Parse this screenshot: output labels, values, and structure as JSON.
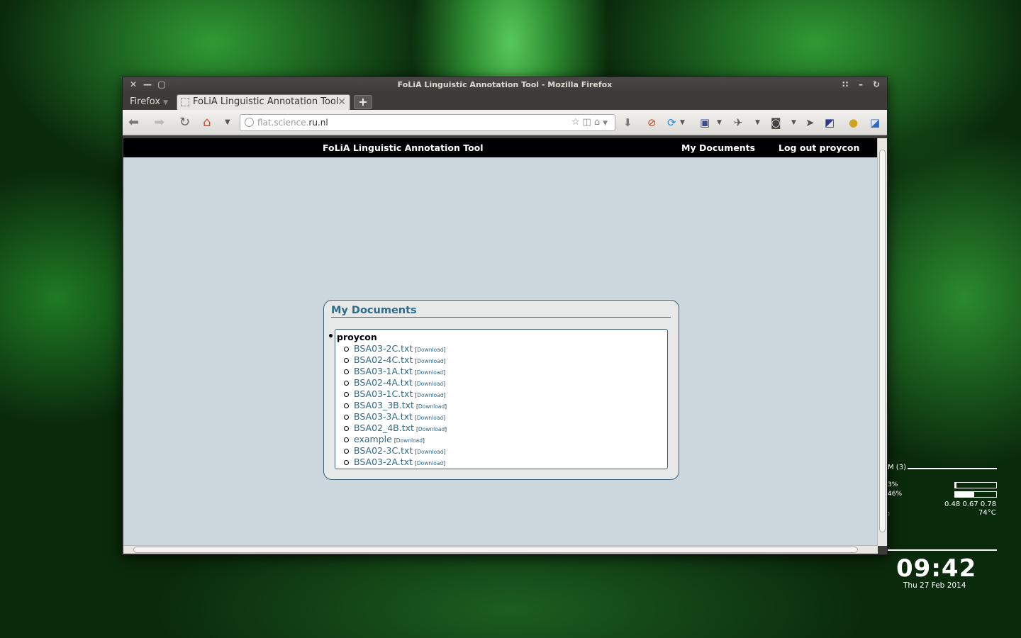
{
  "window": {
    "title": "FoLiA Linguistic Annotation Tool - Mozilla Firefox",
    "firefox_menu": "Firefox",
    "tab_title": "FoLiA Linguistic Annotation Tool",
    "url_prefix": "flat.science.",
    "url_host": "ru.nl"
  },
  "site": {
    "brand": "FoLiA Linguistic Annotation Tool",
    "nav_my_documents": "My Documents",
    "nav_logout": "Log out proycon"
  },
  "panel": {
    "title": "My Documents",
    "owner": "proycon",
    "download_label": "Download",
    "files": [
      {
        "name": "BSA03-2C.txt"
      },
      {
        "name": "BSA02-4C.txt"
      },
      {
        "name": "BSA03-1A.txt"
      },
      {
        "name": "BSA02-4A.txt"
      },
      {
        "name": "BSA03-1C.txt"
      },
      {
        "name": "BSA03_3B.txt"
      },
      {
        "name": "BSA03-3A.txt"
      },
      {
        "name": "BSA02_4B.txt"
      },
      {
        "name": "example"
      },
      {
        "name": "BSA02-3C.txt"
      },
      {
        "name": "BSA03-2A.txt"
      }
    ]
  },
  "desktop_widget": {
    "header": "M (3)",
    "row1_label": "3%",
    "row1_fill": 0.03,
    "row2_label": "46%",
    "row2_fill": 0.46,
    "load": "0.48 0.67 0.78",
    "temp": "74°C",
    "row_colon": ":",
    "time": "09:42",
    "date": "Thu 27 Feb 2014"
  },
  "icons": [
    "close-icon",
    "minimize-icon",
    "maximize-icon",
    "back-arrow-icon",
    "forward-arrow-icon",
    "reload-icon",
    "home-icon",
    "bookmark-star-icon",
    "download-arrow-icon"
  ]
}
